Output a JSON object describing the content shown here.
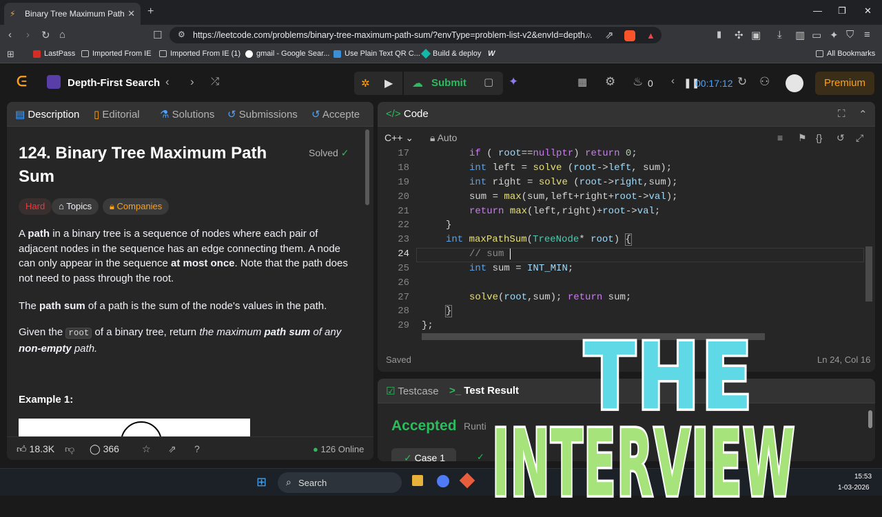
{
  "browser": {
    "tab_title": "Binary Tree Maximum Path Sum",
    "url": "https://leetcode.com/problems/binary-tree-maximum-path-sum/?envType=problem-list-v2&envId=depth...",
    "bookmarks": [
      "LastPass",
      "Imported From IE",
      "Imported From IE (1)",
      "gmail - Google Sear...",
      "Use Plain Text QR C...",
      "Build & deploy"
    ],
    "all_bookmarks": "All Bookmarks"
  },
  "header": {
    "problem_list": "Depth-First Search",
    "submit_label": "Submit",
    "streak": "0",
    "timer": "00:17:12",
    "premium": "Premium"
  },
  "left": {
    "tabs": [
      "Description",
      "Editorial",
      "Solutions",
      "Submissions",
      "Accepte"
    ],
    "title_line1": "124. Binary Tree Maximum Path",
    "title_line2": "Sum",
    "solved": "Solved",
    "difficulty": "Hard",
    "topics": "Topics",
    "companies": "Companies",
    "p1": {
      "a": "A ",
      "b": "path",
      "c": " in a binary tree is a sequence of nodes where each pair of adjacent nodes in the sequence has an edge connecting them. A node can only appear in the sequence ",
      "d": "at most once",
      "e": ". Note that the path does not need to pass through the root."
    },
    "p2": {
      "a": "The ",
      "b": "path sum",
      "c": " of a path is the sum of the node's values in the path."
    },
    "p3": {
      "a": "Given the ",
      "code": "root",
      "b": " of a binary tree, return ",
      "c": "the maximum ",
      "d": "path sum",
      "e": " of any ",
      "f": "non-empty",
      "g": " path."
    },
    "example": "Example 1:",
    "likes": "18.3K",
    "comments": "366",
    "online": "126 Online"
  },
  "code": {
    "title": "Code",
    "lang": "C++",
    "mode": "Auto",
    "lines": [
      {
        "n": "17"
      },
      {
        "n": "18"
      },
      {
        "n": "19"
      },
      {
        "n": "20"
      },
      {
        "n": "21"
      },
      {
        "n": "22"
      },
      {
        "n": "23"
      },
      {
        "n": "24"
      },
      {
        "n": "25"
      },
      {
        "n": "26"
      },
      {
        "n": "27"
      },
      {
        "n": "28"
      },
      {
        "n": "29"
      }
    ],
    "saved": "Saved",
    "cursor": "Ln 24, Col 16"
  },
  "test": {
    "tab1": "Testcase",
    "tab2": "Test Result",
    "status": "Accepted",
    "runtime": "Runti",
    "case1": "Case 1"
  },
  "taskbar": {
    "search": "Search",
    "time": "15:53",
    "date": "1-03-2026"
  },
  "overlay": {
    "line1": "THE",
    "line2": "INTERVIEW"
  },
  "colors": {
    "accepted": "#2cbb5d",
    "premium": "#ffa116",
    "hard": "#f63636",
    "overlay_top": "#5fd9e6",
    "overlay_bottom": "#a6e37a"
  }
}
